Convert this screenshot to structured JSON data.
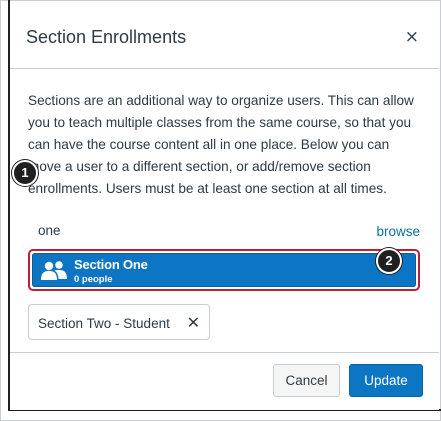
{
  "dialog": {
    "title": "Section Enrollments",
    "close_symbol": "×",
    "description": "Sections are an additional way to organize users. This can allow you to teach multiple classes from the same course, so that you can have the course content all in one place. Below you can move a user to a different section, or add/remove section enrollments. Users must be at least one section at all times."
  },
  "search": {
    "value": "one",
    "browse_label": "browse"
  },
  "result": {
    "name": "Section One",
    "count": "0 people",
    "icon": "users-icon"
  },
  "enrolled": {
    "label": "Section Two - Student",
    "remove_symbol": "✕"
  },
  "callouts": {
    "first": "1",
    "second": "2"
  },
  "buttons": {
    "cancel": "Cancel",
    "update": "Update"
  },
  "colors": {
    "accent": "#0c76c4",
    "highlight_border": "#c01e33",
    "link": "#0770a3"
  }
}
